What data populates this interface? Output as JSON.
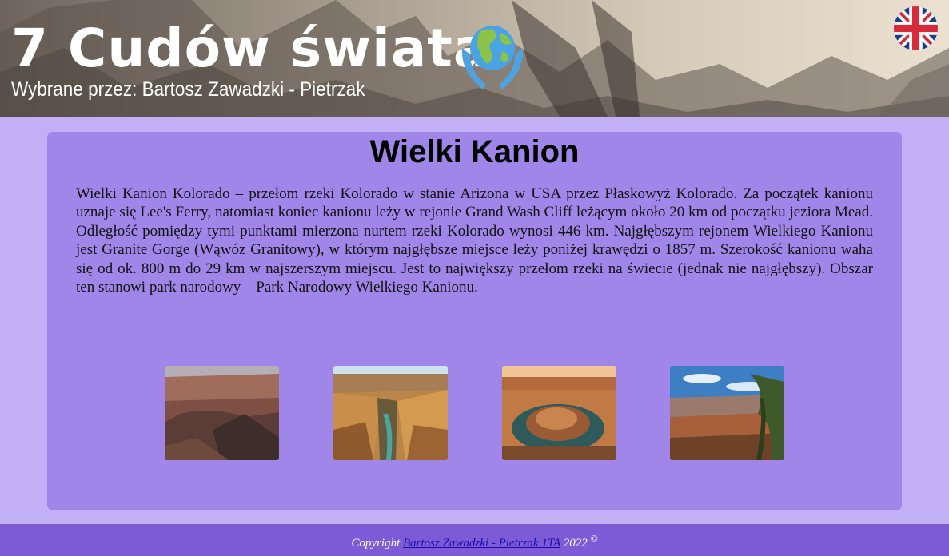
{
  "header": {
    "title": "7 Cudów świata",
    "subtitle": "Wybrane przez: Bartosz Zawadzki - Pietrzak",
    "logo_icon": "globe-in-hands-icon",
    "language_icon": "uk-flag-icon"
  },
  "main": {
    "title": "Wielki Kanion",
    "description": "Wielki Kanion Kolorado – przełom rzeki Kolorado w stanie Arizona w USA przez Płaskowyż Kolorado. Za początek kanionu uznaje się Lee's Ferry, natomiast koniec kanionu leży w rejonie Grand Wash Cliff leżącym około 20 km od początku jeziora Mead. Odległość pomiędzy tymi punktami mierzona nurtem rzeki Kolorado wynosi 446 km. Najgłębszym rejonem Wielkiego Kanionu jest Granite Gorge (Wąwóz Granitowy), w którym najgłębsze miejsce leży poniżej krawędzi o 1857 m. Szerokość kanionu waha się od ok. 800 m do 29 km w najszerszym miejscu. Jest to największy przełom rzeki na świecie (jednak nie najgłębszy). Obszar ten stanowi park narodowy – Park Narodowy Wielkiego Kanionu.",
    "gallery": [
      {
        "name": "canyon-photo-1"
      },
      {
        "name": "canyon-photo-2"
      },
      {
        "name": "canyon-photo-3"
      },
      {
        "name": "canyon-photo-4"
      }
    ]
  },
  "footer": {
    "prefix": "Copyright",
    "link_text": "Bartosz Zawadzki - Pietrzak 1TA",
    "year": "2022",
    "symbol": "©"
  },
  "colors": {
    "page_bg": "#c2b0f6",
    "card_bg": "#a186ea",
    "footer_bg": "#7e5bd6"
  }
}
